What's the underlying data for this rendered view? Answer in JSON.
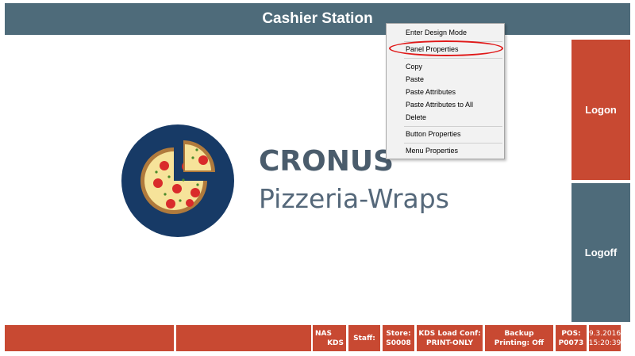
{
  "title": "Cashier Station",
  "side_buttons": {
    "logon": "Logon",
    "logoff": "Logoff"
  },
  "brand": {
    "name": "CRONUS",
    "subtitle": "Pizzeria-Wraps"
  },
  "context_menu": {
    "items": [
      "Enter Design Mode",
      "Panel Properties",
      "Copy",
      "Paste",
      "Paste Attributes",
      "Paste Attributes to All",
      "Delete",
      "Button Properties",
      "Menu Properties"
    ],
    "highlighted": "Panel Properties"
  },
  "statusbar": {
    "nas": "NAS",
    "kds": "KDS",
    "staff": "Staff:",
    "store_label": "Store:",
    "store_value": "S0008",
    "kds_conf_label": "KDS Load Conf:",
    "kds_conf_value": "PRINT-ONLY",
    "backup_label": "Backup",
    "backup_value": "Printing: Off",
    "pos_label": "POS:",
    "pos_value": "P0073",
    "date": "9.3.2016",
    "time": "15:20:39"
  },
  "colors": {
    "header": "#4e6b7a",
    "accent": "#c84932",
    "logo_bg": "#173a66",
    "highlight": "#e01919"
  }
}
